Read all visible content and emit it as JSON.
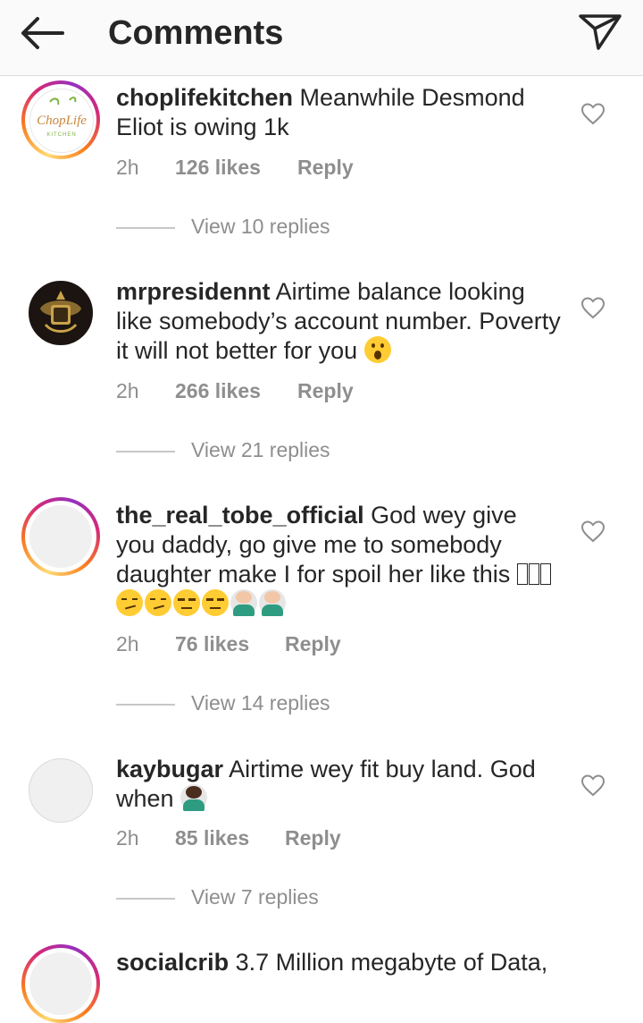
{
  "header": {
    "title": "Comments"
  },
  "comments": [
    {
      "username": "choplifekitchen",
      "text": "Meanwhile Desmond Eliot is owing 1k",
      "avatar_logo_text": "ChopLife",
      "avatar_logo_sub": "KITCHEN",
      "time": "2h",
      "likes": "126 likes",
      "reply": "Reply",
      "view_replies": "View 10 replies"
    },
    {
      "username": "mrpresidennt",
      "text": "Airtime balance looking like somebody’s account number. Poverty it will not better for you",
      "time": "2h",
      "likes": "266 likes",
      "reply": "Reply",
      "view_replies": "View 21 replies"
    },
    {
      "username": "the_real_tobe_official",
      "text": "God wey give you daddy, go give me to somebody daughter make I for spoil her like this",
      "time": "2h",
      "likes": "76 likes",
      "reply": "Reply",
      "view_replies": "View 14 replies"
    },
    {
      "username": "kaybugar",
      "text": "Airtime wey fit buy land. God when",
      "time": "2h",
      "likes": "85 likes",
      "reply": "Reply",
      "view_replies": "View 7 replies"
    },
    {
      "username": "socialcrib",
      "text": "3.7 Million megabyte of Data,"
    }
  ],
  "icons": {
    "back": "back-arrow-icon",
    "send": "send-icon",
    "like": "heart-icon",
    "emoji_wow": "face-with-open-mouth-emoji",
    "emoji_smirk": "smirking-face-emoji",
    "emoji_unamused": "unamused-face-emoji",
    "emoji_facepalm": "man-facepalming-emoji",
    "emoji_missing": "missing-glyph-box"
  },
  "colors": {
    "text": "#262626",
    "secondary": "#8e8e8e",
    "divider": "#dbdbdb",
    "header_bg": "#fafafa",
    "story_ring": [
      "#feda75",
      "#fa7e1e",
      "#d62976",
      "#962fbf"
    ]
  }
}
